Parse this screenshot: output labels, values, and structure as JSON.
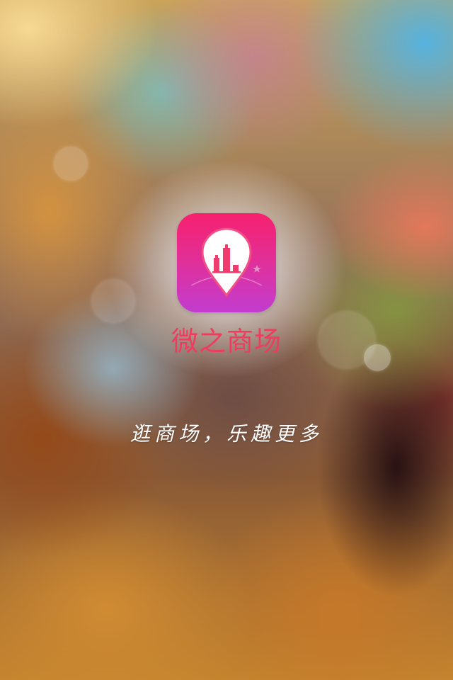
{
  "app": {
    "name": "微之商场",
    "slogan": "逛商场，乐趣更多",
    "icon": "map-pin-buildings-icon"
  },
  "colors": {
    "app_name": "#ef3b5e",
    "icon_gradient_top": "#f7206e",
    "icon_gradient_bottom": "#c23cd0",
    "slogan": "#ffffff"
  }
}
